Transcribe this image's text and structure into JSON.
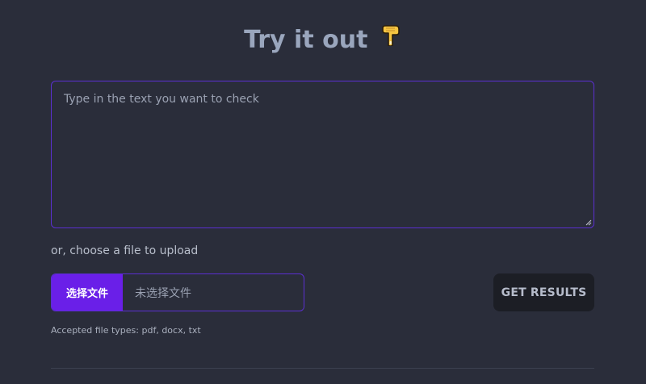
{
  "header": {
    "title": "Try it out",
    "emoji": "👇",
    "emoji_icon": "pointing-down-hand-icon"
  },
  "text_input": {
    "placeholder": "Type in the text you want to check",
    "value": ""
  },
  "upload": {
    "label": "or, choose a file to upload",
    "choose_button_label": "选择文件",
    "no_file_text": "未选择文件",
    "accepted_types_text": "Accepted file types: pdf, docx, txt"
  },
  "actions": {
    "get_results_label": "GET RESULTS"
  },
  "colors": {
    "background": "#2a2d3a",
    "accent": "#6a1fe8",
    "border_accent": "#5b2fd1",
    "title_text": "#9aa6bd",
    "button_dark": "#1c1e25"
  }
}
